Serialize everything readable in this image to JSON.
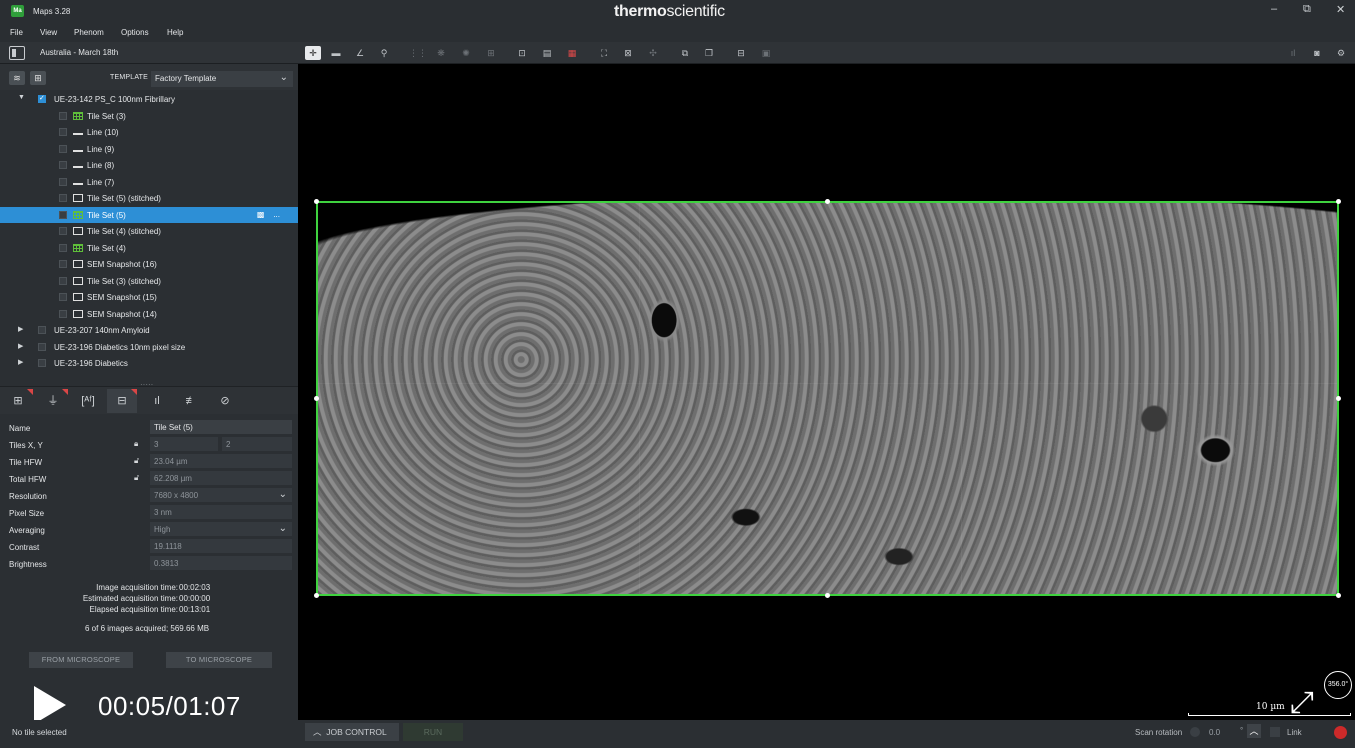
{
  "window": {
    "app_badge": "Ma",
    "title": "Maps 3.28",
    "brand_bold": "thermo",
    "brand_light": "scientific",
    "minimize": "–",
    "restore": "⧉",
    "close": "✕"
  },
  "menu": [
    "File",
    "View",
    "Phenom",
    "Options",
    "Help"
  ],
  "project": {
    "name": "Australia - March 18th"
  },
  "template": {
    "label": "TEMPLATE",
    "value": "Factory Template"
  },
  "tree": {
    "root": "UE-23-142 PS_C 100nm Fibrillary",
    "children": [
      {
        "label": "Tile Set (3)",
        "icon": "tile-set-icon"
      },
      {
        "label": "Line (10)",
        "icon": "line-icon"
      },
      {
        "label": "Line (9)",
        "icon": "line-icon"
      },
      {
        "label": "Line (8)",
        "icon": "line-icon"
      },
      {
        "label": "Line (7)",
        "icon": "line-icon"
      },
      {
        "label": "Tile Set (5) (stitched)",
        "icon": "image-icon"
      },
      {
        "label": "Tile Set (5)",
        "icon": "tile-set-icon",
        "selected": true
      },
      {
        "label": "Tile Set (4) (stitched)",
        "icon": "image-icon"
      },
      {
        "label": "Tile Set (4)",
        "icon": "tile-set-icon"
      },
      {
        "label": "SEM Snapshot (16)",
        "icon": "image-icon"
      },
      {
        "label": "Tile Set (3) (stitched)",
        "icon": "image-icon"
      },
      {
        "label": "SEM Snapshot (15)",
        "icon": "image-icon"
      },
      {
        "label": "SEM Snapshot (14)",
        "icon": "image-icon"
      }
    ],
    "others": [
      "UE-23-207 140nm Amyloid",
      "UE-23-196 Diabetics 10nm pixel size",
      "UE-23-196 Diabetics"
    ],
    "row_more": "..."
  },
  "properties": {
    "name": {
      "label": "Name",
      "value": "Tile Set (5)"
    },
    "tiles": {
      "label": "Tiles X, Y",
      "x": "3",
      "y": "2"
    },
    "tile_hfw": {
      "label": "Tile HFW",
      "value": "23.04 µm"
    },
    "total_hfw": {
      "label": "Total HFW",
      "value": "62.208 µm"
    },
    "resolution": {
      "label": "Resolution",
      "value": "7680 x 4800"
    },
    "pixel_size": {
      "label": "Pixel Size",
      "value": "3 nm"
    },
    "averaging": {
      "label": "Averaging",
      "value": "High"
    },
    "contrast": {
      "label": "Contrast",
      "value": "19.1118"
    },
    "brightness": {
      "label": "Brightness",
      "value": "0.3813"
    }
  },
  "acquisition": {
    "image_label": "Image acquisition time:",
    "image_value": "00:02:03",
    "estimated_label": "Estimated acquisition time:",
    "estimated_value": "00:00:00",
    "elapsed_label": "Elapsed acquisition time:",
    "elapsed_value": "00:13:01",
    "summary": "6 of 6 images acquired;   569.66 MB"
  },
  "buttons": {
    "from_microscope": "FROM MICROSCOPE",
    "to_microscope": "TO MICROSCOPE"
  },
  "player": {
    "timecode": "00:05/01:07"
  },
  "viewer": {
    "scale_label": "10 µm",
    "rotation_badge": "356.0°"
  },
  "statusbar": {
    "status": "No tile selected",
    "job_control": "JOB CONTROL",
    "run": "RUN",
    "scan_rotation_label": "Scan rotation",
    "scan_rotation_value": "0.0",
    "scan_rotation_unit": "°",
    "link_label": "Link"
  },
  "colors": {
    "selection": "#2d8fd6",
    "bbox": "#3fd23f",
    "record": "#cc2a2a"
  }
}
